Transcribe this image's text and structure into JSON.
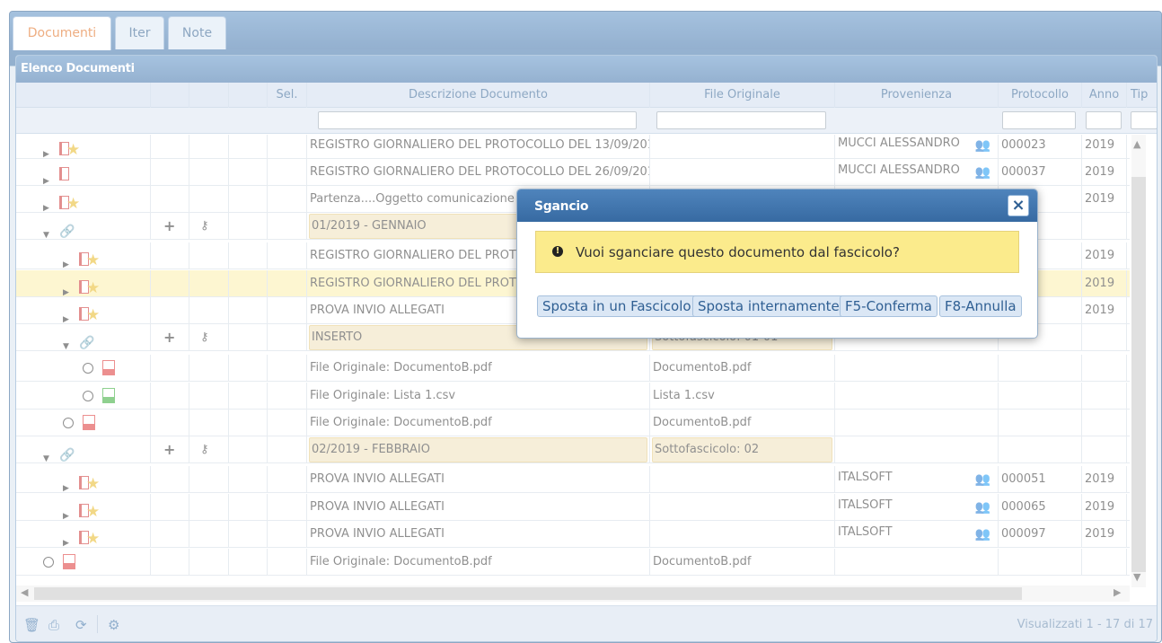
{
  "tabs": {
    "documenti": "Documenti",
    "iter": "Iter",
    "note": "Note"
  },
  "panel": {
    "title": "Elenco Documenti"
  },
  "columns": {
    "sel": "Sel.",
    "descrizione": "Descrizione Documento",
    "file": "File Originale",
    "provenienza": "Provenienza",
    "protocollo": "Protocollo",
    "anno": "Anno",
    "tipo": "Tip"
  },
  "rows": [
    {
      "descrizione": "REGISTRO GIORNALIERO DEL PROTOCOLLO DEL  13/09/2019",
      "file": "",
      "provenienza": "MUCCI ALESSANDRO",
      "protocollo": "000023",
      "anno": "2019"
    },
    {
      "descrizione": "REGISTRO GIORNALIERO DEL PROTOCOLLO DEL  26/09/2019",
      "file": "",
      "provenienza": "MUCCI ALESSANDRO",
      "protocollo": "000037",
      "anno": "2019"
    },
    {
      "descrizione": "Partenza....Oggetto comunicazione p",
      "file": "",
      "provenienza": "",
      "protocollo": "2",
      "anno": "2019"
    },
    {
      "descrizione": "01/2019 - GENNAIO",
      "file": "",
      "provenienza": "",
      "protocollo": "",
      "anno": ""
    },
    {
      "descrizione": "REGISTRO GIORNALIERO DEL PROTO",
      "file": "",
      "provenienza": "",
      "protocollo": "1",
      "anno": "2019"
    },
    {
      "descrizione": "REGISTRO GIORNALIERO DEL PROTO",
      "file": "",
      "provenienza": "",
      "protocollo": "2",
      "anno": "2019"
    },
    {
      "descrizione": "PROVA INVIO ALLEGATI",
      "file": "",
      "provenienza": "",
      "protocollo": "3",
      "anno": "2019"
    },
    {
      "descrizione": "INSERTO",
      "file": "Sottofascicolo: 01-01",
      "provenienza": "",
      "protocollo": "",
      "anno": ""
    },
    {
      "descrizione": "File Originale: DocumentoB.pdf",
      "file": "DocumentoB.pdf",
      "provenienza": "",
      "protocollo": "",
      "anno": ""
    },
    {
      "descrizione": "File Originale: Lista 1.csv",
      "file": "Lista 1.csv",
      "provenienza": "",
      "protocollo": "",
      "anno": ""
    },
    {
      "descrizione": "File Originale: DocumentoB.pdf",
      "file": "DocumentoB.pdf",
      "provenienza": "",
      "protocollo": "",
      "anno": ""
    },
    {
      "descrizione": "02/2019 - FEBBRAIO",
      "file": "Sottofascicolo: 02",
      "provenienza": "",
      "protocollo": "",
      "anno": ""
    },
    {
      "descrizione": "PROVA INVIO ALLEGATI",
      "file": "",
      "provenienza": "ITALSOFT",
      "protocollo": "000051",
      "anno": "2019"
    },
    {
      "descrizione": "PROVA INVIO ALLEGATI",
      "file": "",
      "provenienza": "ITALSOFT",
      "protocollo": "000065",
      "anno": "2019"
    },
    {
      "descrizione": "PROVA INVIO ALLEGATI",
      "file": "",
      "provenienza": "ITALSOFT",
      "protocollo": "000097",
      "anno": "2019"
    },
    {
      "descrizione": "File Originale: DocumentoB.pdf",
      "file": "DocumentoB.pdf",
      "provenienza": "",
      "protocollo": "",
      "anno": ""
    }
  ],
  "footer": {
    "status": "Visualizzati 1 - 17 di 17"
  },
  "dialog": {
    "title": "Sgancio",
    "close": "×",
    "message": "Vuoi sganciare questo documento dal fascicolo?",
    "buttons": {
      "fascicolo": "Sposta in un Fascicolo",
      "interno": "Sposta internamente",
      "conferma": "F5-Conferma",
      "annulla": "F8-Annulla"
    }
  },
  "icons": {
    "expand": "triangle-right",
    "collapse": "triangle-down",
    "add": "+",
    "key": "key-icon"
  }
}
